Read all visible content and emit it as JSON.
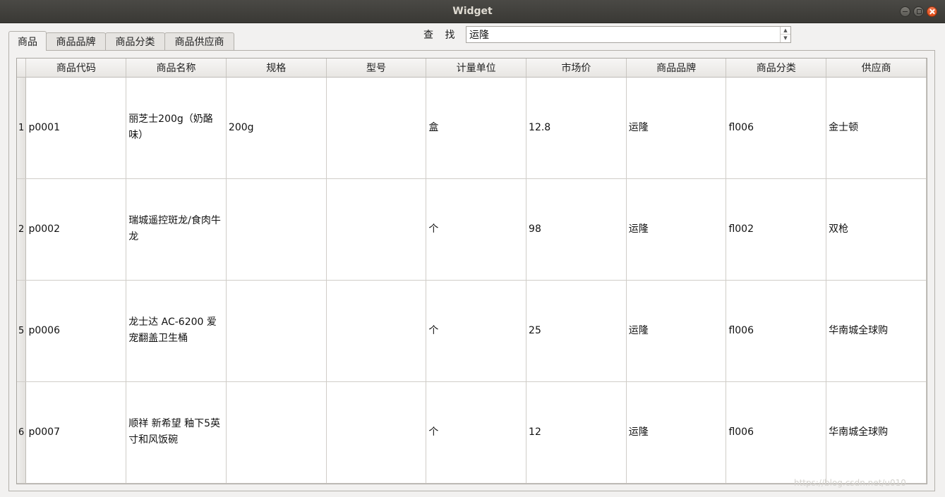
{
  "window": {
    "title": "Widget"
  },
  "tabs": [
    {
      "label": "商品",
      "active": true
    },
    {
      "label": "商品品牌",
      "active": false
    },
    {
      "label": "商品分类",
      "active": false
    },
    {
      "label": "商品供应商",
      "active": false
    }
  ],
  "search": {
    "label": "查 找",
    "value": "运隆"
  },
  "table": {
    "headers": [
      "商品代码",
      "商品名称",
      "规格",
      "型号",
      "计量单位",
      "市场价",
      "商品品牌",
      "商品分类",
      "供应商"
    ],
    "rows": [
      {
        "row": "1",
        "code": "p0001",
        "name": "丽芝士200g（奶酪味）",
        "spec": "200g",
        "model": "",
        "unit": "盒",
        "price": "12.8",
        "brand": "运隆",
        "category": "fl006",
        "supplier": "金士顿"
      },
      {
        "row": "2",
        "code": "p0002",
        "name": "瑞城遥控斑龙/食肉牛龙",
        "spec": "",
        "model": "",
        "unit": "个",
        "price": "98",
        "brand": "运隆",
        "category": "fl002",
        "supplier": "双枪"
      },
      {
        "row": "5",
        "code": "p0006",
        "name": "龙士达 AC-6200 爱宠翻盖卫生桶",
        "spec": "",
        "model": "",
        "unit": "个",
        "price": "25",
        "brand": "运隆",
        "category": "fl006",
        "supplier": "华南城全球购"
      },
      {
        "row": "6",
        "code": "p0007",
        "name": "顺祥 新希望 釉下5英寸和风饭碗",
        "spec": "",
        "model": "",
        "unit": "个",
        "price": "12",
        "brand": "运隆",
        "category": "fl006",
        "supplier": "华南城全球购"
      }
    ]
  },
  "watermark": "https://blog.csdn.net/u010"
}
